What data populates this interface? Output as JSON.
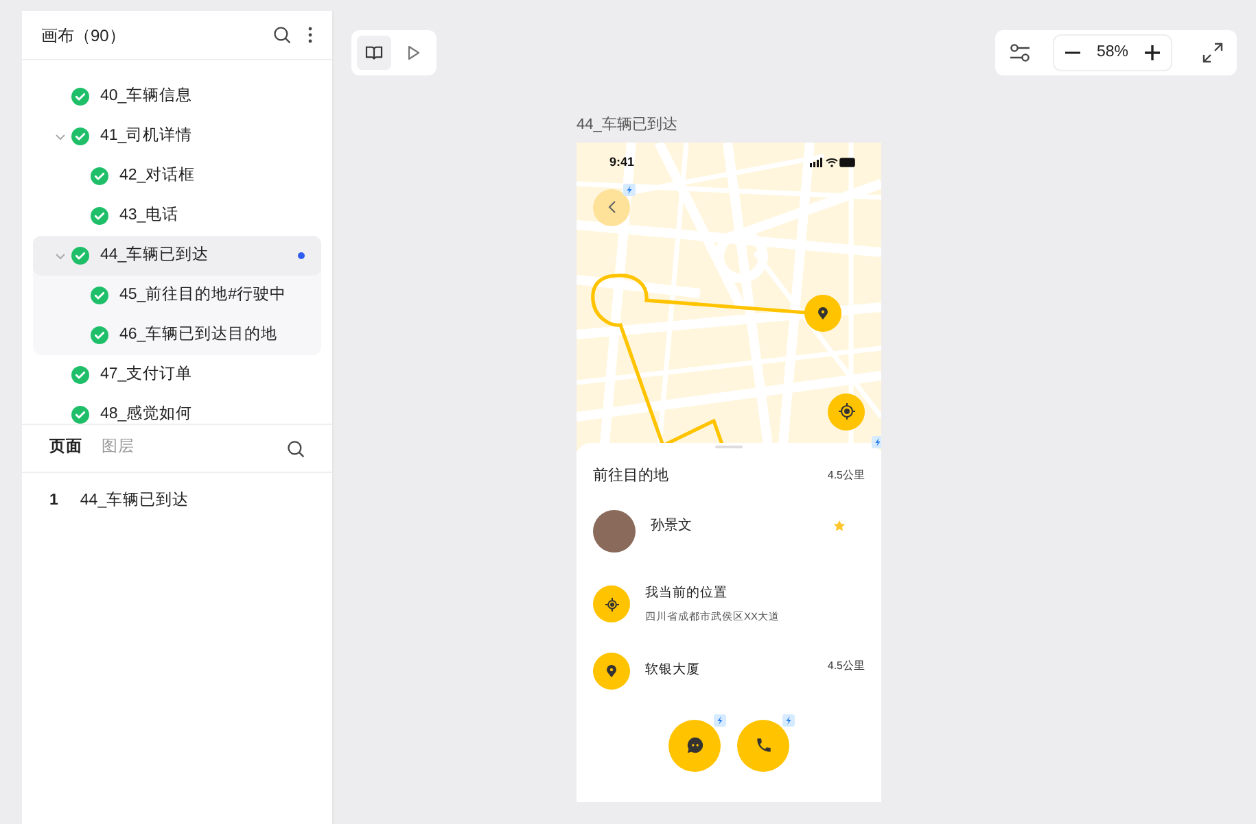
{
  "sidebar": {
    "title": "画布（90）",
    "tree": [
      {
        "label": "40_车辆信息",
        "selected": false
      },
      {
        "label": "41_司机详情",
        "selected": false,
        "expanded": true,
        "children": [
          {
            "label": "42_对话框",
            "selected": false
          },
          {
            "label": "43_电话",
            "selected": false
          }
        ]
      },
      {
        "label": "44_车辆已到达",
        "selected": true,
        "expanded": true,
        "children": [
          {
            "label": "45_前往目的地#行驶中",
            "selected": false
          },
          {
            "label": "46_车辆已到达目的地",
            "selected": false
          }
        ]
      },
      {
        "label": "47_支付订单",
        "selected": false
      },
      {
        "label": "48_感觉如何",
        "selected": false
      }
    ],
    "tabs": [
      {
        "label": "页面",
        "selected": true
      },
      {
        "label": "图层",
        "selected": false
      }
    ],
    "pages": [
      {
        "number": "1",
        "label": "44_车辆已到达"
      }
    ]
  },
  "toolbar": {
    "modes": [
      {
        "kind": "book",
        "selected": true
      },
      {
        "kind": "play",
        "selected": false
      }
    ],
    "zoom": "58%"
  },
  "frame": {
    "title": "44_车辆已到达",
    "time": "9:41",
    "sheet": {
      "title": "前往目的地",
      "distance": "4.5公里",
      "driver": "孙景文",
      "locations": [
        {
          "kind": "current",
          "title": "我当前的位置",
          "address": "四川省成都市武侯区XX大道"
        },
        {
          "kind": "destination",
          "title": "软银大厦",
          "distance": "4.5公里"
        }
      ]
    }
  }
}
